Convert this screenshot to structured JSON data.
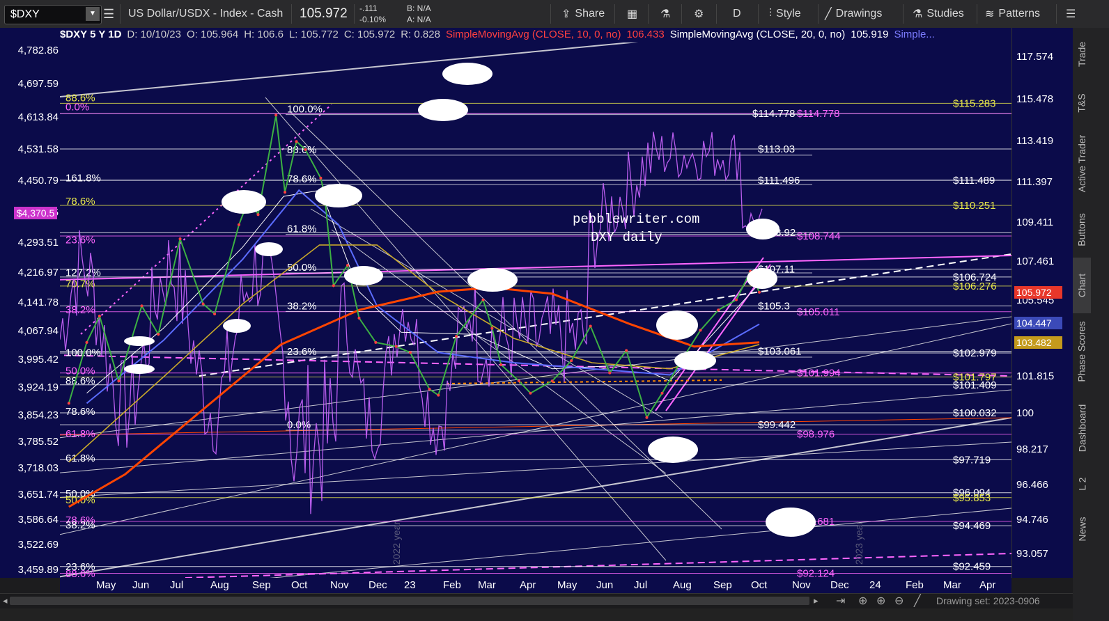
{
  "toolbar": {
    "symbol": "$DXY",
    "description": "US Dollar/USDX - Index - Cash",
    "price": "105.972",
    "change": "-.111",
    "change_pct": "-0.10%",
    "bid": "B: N/A",
    "ask": "A: N/A",
    "share": "Share",
    "period": "D",
    "style": "Style",
    "drawings": "Drawings",
    "studies": "Studies",
    "patterns": "Patterns"
  },
  "infobar": {
    "title": "$DXY 5 Y 1D",
    "date": "D: 10/10/23",
    "open": "O: 105.964",
    "high": "H: 106.6",
    "low": "L: 105.772",
    "close": "C: 105.972",
    "range": "R: 0.828",
    "sma10_label": "SimpleMovingAvg (CLOSE, 10, 0, no)",
    "sma10_value": "106.433",
    "sma20_label": "SimpleMovingAvg (CLOSE, 20, 0, no)",
    "sma20_value": "105.919",
    "more": "Simple..."
  },
  "sidebar": [
    "Trade",
    "T&S",
    "Active Trader",
    "Buttons",
    "Chart",
    "Phase Scores",
    "Dashboard",
    "L 2",
    "News"
  ],
  "bottom": {
    "drawing_set": "Drawing set: 2023-0906"
  },
  "colors": {
    "background": "#0b0b4a",
    "price": "#e0e0e0",
    "ma_red": "#ff4500",
    "ma_blue": "#5b6cff",
    "ma_gold": "#c8a82a",
    "oscillator": "#cc66ff",
    "fib_yellow": "#e8e84a",
    "fib_magenta": "#ff66ff"
  },
  "chart_data": {
    "type": "line",
    "title": "$DXY 5 Y 1D",
    "watermark": "pebblewriter.com\nDXY daily",
    "period_labels": [
      "2022 year",
      "2023 year"
    ],
    "left_axis_ticks": [
      "4,782.86",
      "4,697.59",
      "4,613.84",
      "4,531.58",
      "4,450.79",
      "4,370.5",
      "4,293.51",
      "4,216.97",
      "4,141.78",
      "4,067.94",
      "3,995.42",
      "3,924.19",
      "3,854.23",
      "3,785.52",
      "3,718.03",
      "3,651.74",
      "3,586.64",
      "3,522.69",
      "3,459.89"
    ],
    "right_axis_ticks": [
      "117.574",
      "115.478",
      "113.419",
      "111.397",
      "109.411",
      "107.461",
      "105.545",
      "101.815",
      "100",
      "98.217",
      "96.466",
      "94.746",
      "93.057"
    ],
    "x_ticks": [
      "May",
      "Jun",
      "Jul",
      "Aug",
      "Sep",
      "Oct",
      "Nov",
      "Dec",
      "23",
      "Feb",
      "Mar",
      "Apr",
      "May",
      "Jun",
      "Jul",
      "Aug",
      "Sep",
      "Oct",
      "Nov",
      "Dec",
      "24",
      "Feb",
      "Mar",
      "Apr"
    ],
    "ylim": [
      91.9,
      119.0
    ],
    "left_ylim": [
      3440,
      4842
    ],
    "current_price": 105.972,
    "price_badges": [
      {
        "label": "105.972",
        "color": "#e8372a",
        "value": 105.972
      },
      {
        "label": "104.447",
        "color": "#3b4ab8",
        "value": 104.447
      },
      {
        "label": "103.482",
        "color": "#c49a1c",
        "value": 103.482
      }
    ],
    "left_badge": {
      "label": "$4,370.5",
      "value": 4370.5
    },
    "levels": [
      {
        "label": "$115.283",
        "value": 115.283,
        "color": "#e8e84a"
      },
      {
        "label": "$114.778",
        "value": 114.778,
        "color": "#ffffff"
      },
      {
        "label": "$114.778",
        "value": 114.778,
        "color": "#ff66ff"
      },
      {
        "label": "$113.03",
        "value": 113.03,
        "color": "#ffffff"
      },
      {
        "label": "$111.496",
        "value": 111.496,
        "color": "#ffffff"
      },
      {
        "label": "$111.489",
        "value": 111.489,
        "color": "#ffffff"
      },
      {
        "label": "$110.251",
        "value": 110.251,
        "color": "#e8e84a"
      },
      {
        "label": "$108.92",
        "value": 108.92,
        "color": "#ffffff"
      },
      {
        "label": "$108.744",
        "value": 108.744,
        "color": "#ff66ff"
      },
      {
        "label": "$107.11",
        "value": 107.11,
        "color": "#ffffff"
      },
      {
        "label": "$106.724",
        "value": 106.724,
        "color": "#ffffff"
      },
      {
        "label": "$106.276",
        "value": 106.276,
        "color": "#e8e84a"
      },
      {
        "label": "$105.3",
        "value": 105.3,
        "color": "#ffffff"
      },
      {
        "label": "$105.011",
        "value": 105.011,
        "color": "#ff66ff"
      },
      {
        "label": "$103.061",
        "value": 103.061,
        "color": "#ffffff"
      },
      {
        "label": "$102.979",
        "value": 102.979,
        "color": "#ffffff"
      },
      {
        "label": "$101.994",
        "value": 101.994,
        "color": "#ff66ff"
      },
      {
        "label": "$101.797",
        "value": 101.797,
        "color": "#e8e84a"
      },
      {
        "label": "$101.409",
        "value": 101.409,
        "color": "#ffffff"
      },
      {
        "label": "$100.032",
        "value": 100.032,
        "color": "#ffffff"
      },
      {
        "label": "$99.442",
        "value": 99.442,
        "color": "#ffffff"
      },
      {
        "label": "$98.976",
        "value": 98.976,
        "color": "#ff66ff"
      },
      {
        "label": "$97.719",
        "value": 97.719,
        "color": "#ffffff"
      },
      {
        "label": "$96.094",
        "value": 96.094,
        "color": "#ffffff"
      },
      {
        "label": "$95.853",
        "value": 95.853,
        "color": "#e8e84a"
      },
      {
        "label": "$94.681",
        "value": 94.681,
        "color": "#ff66ff"
      },
      {
        "label": "$94.469",
        "value": 94.469,
        "color": "#ffffff"
      },
      {
        "label": "$92.459",
        "value": 92.459,
        "color": "#ffffff"
      },
      {
        "label": "$92.124",
        "value": 92.124,
        "color": "#ff66ff"
      }
    ],
    "fib_left": [
      {
        "label": "88.6%",
        "value": 115.55,
        "color": "#e8e84a"
      },
      {
        "label": "0.0%",
        "value": 115.1,
        "color": "#ff66ff"
      },
      {
        "label": "161.8%",
        "value": 111.6,
        "color": "#ffffff"
      },
      {
        "label": "78.6%",
        "value": 110.45,
        "color": "#e8e84a"
      },
      {
        "label": "23.6%",
        "value": 108.55,
        "color": "#ff66ff"
      },
      {
        "label": "127.2%",
        "value": 106.95,
        "color": "#ffffff"
      },
      {
        "label": "70.7%",
        "value": 106.4,
        "color": "#e8e84a"
      },
      {
        "label": "38.2%",
        "value": 105.1,
        "color": "#ff66ff"
      },
      {
        "label": "100.0%",
        "value": 103.0,
        "color": "#ffffff"
      },
      {
        "label": "50.0%",
        "value": 102.1,
        "color": "#ff66ff"
      },
      {
        "label": "88.6%",
        "value": 101.6,
        "color": "#ffffff"
      },
      {
        "label": "78.6%",
        "value": 100.1,
        "color": "#ffffff"
      },
      {
        "label": "61.8%",
        "value": 99.0,
        "color": "#ff66ff"
      },
      {
        "label": "61.8%",
        "value": 97.8,
        "color": "#ffffff"
      },
      {
        "label": "50.0%",
        "value": 96.05,
        "color": "#ffffff"
      },
      {
        "label": "50.0%",
        "value": 95.75,
        "color": "#e8e84a"
      },
      {
        "label": "78.6%",
        "value": 94.75,
        "color": "#ff66ff"
      },
      {
        "label": "38.2%",
        "value": 94.5,
        "color": "#ffffff"
      },
      {
        "label": "23.6%",
        "value": 92.45,
        "color": "#ffffff"
      },
      {
        "label": "88.6%",
        "value": 92.1,
        "color": "#ff66ff"
      }
    ],
    "fib_mid": [
      {
        "label": "100.0%",
        "value": 115.0
      },
      {
        "label": "88.6%",
        "value": 113.0
      },
      {
        "label": "78.6%",
        "value": 111.55
      },
      {
        "label": "61.8%",
        "value": 109.1
      },
      {
        "label": "50.0%",
        "value": 107.2
      },
      {
        "label": "38.2%",
        "value": 105.3
      },
      {
        "label": "23.6%",
        "value": 103.05
      },
      {
        "label": "0.0%",
        "value": 99.45
      }
    ],
    "series": [
      {
        "name": "$DXY",
        "values": [
          [
            "2022-04-18",
            100.5
          ],
          [
            "2022-05-02",
            103.5
          ],
          [
            "2022-05-12",
            104.8
          ],
          [
            "2022-05-27",
            101.6
          ],
          [
            "2022-06-14",
            105.3
          ],
          [
            "2022-06-27",
            103.9
          ],
          [
            "2022-07-14",
            108.6
          ],
          [
            "2022-08-01",
            105.4
          ],
          [
            "2022-08-10",
            104.9
          ],
          [
            "2022-08-29",
            109.3
          ],
          [
            "2022-09-06",
            110.6
          ],
          [
            "2022-09-13",
            109.8
          ],
          [
            "2022-09-27",
            114.7
          ],
          [
            "2022-10-04",
            110.9
          ],
          [
            "2022-10-13",
            113.4
          ],
          [
            "2022-10-20",
            113.0
          ],
          [
            "2022-11-01",
            111.6
          ],
          [
            "2022-11-04",
            110.8
          ],
          [
            "2022-11-11",
            106.3
          ],
          [
            "2022-11-22",
            107.3
          ],
          [
            "2022-12-01",
            104.7
          ],
          [
            "2022-12-14",
            103.5
          ],
          [
            "2022-12-30",
            103.3
          ],
          [
            "2023-01-10",
            103.0
          ],
          [
            "2023-01-25",
            101.2
          ],
          [
            "2023-02-01",
            100.9
          ],
          [
            "2023-02-15",
            103.8
          ],
          [
            "2023-03-08",
            105.6
          ],
          [
            "2023-03-15",
            104.2
          ],
          [
            "2023-03-22",
            102.4
          ],
          [
            "2023-04-05",
            101.6
          ],
          [
            "2023-04-14",
            101.0
          ],
          [
            "2023-05-01",
            101.6
          ],
          [
            "2023-05-16",
            102.6
          ],
          [
            "2023-05-31",
            104.3
          ],
          [
            "2023-06-15",
            102.0
          ],
          [
            "2023-06-28",
            103.1
          ],
          [
            "2023-07-14",
            99.8
          ],
          [
            "2023-07-26",
            101.0
          ],
          [
            "2023-08-10",
            102.6
          ],
          [
            "2023-08-25",
            104.1
          ],
          [
            "2023-09-08",
            105.1
          ],
          [
            "2023-09-22",
            105.6
          ],
          [
            "2023-10-03",
            107.0
          ],
          [
            "2023-10-10",
            105.972
          ]
        ]
      },
      {
        "name": "SMA 10",
        "values": [
          [
            "2022-05-02",
            101.0
          ],
          [
            "2022-07-01",
            104.2
          ],
          [
            "2022-09-01",
            108.2
          ],
          [
            "2022-10-03",
            110.7
          ],
          [
            "2022-11-01",
            111.0
          ],
          [
            "2022-12-01",
            106.0
          ],
          [
            "2023-01-03",
            104.0
          ],
          [
            "2023-03-01",
            103.9
          ],
          [
            "2023-05-01",
            102.2
          ],
          [
            "2023-07-03",
            102.4
          ],
          [
            "2023-08-01",
            101.6
          ],
          [
            "2023-10-10",
            106.4
          ]
        ]
      },
      {
        "name": "SMA 20",
        "values": [
          [
            "2022-05-02",
            100.5
          ],
          [
            "2022-07-01",
            103.6
          ],
          [
            "2022-09-01",
            107.6
          ],
          [
            "2022-10-15",
            111.0
          ],
          [
            "2022-11-15",
            109.3
          ],
          [
            "2022-12-15",
            105.3
          ],
          [
            "2023-02-01",
            103.0
          ],
          [
            "2023-04-01",
            102.5
          ],
          [
            "2023-06-01",
            102.2
          ],
          [
            "2023-08-01",
            101.9
          ],
          [
            "2023-10-10",
            104.4
          ]
        ]
      },
      {
        "name": "SMA 50",
        "values": [
          [
            "2022-04-18",
            97.6
          ],
          [
            "2022-07-01",
            101.8
          ],
          [
            "2022-09-01",
            105.4
          ],
          [
            "2022-10-31",
            108.3
          ],
          [
            "2022-12-15",
            108.3
          ],
          [
            "2023-02-01",
            105.9
          ],
          [
            "2023-04-01",
            103.7
          ],
          [
            "2023-06-01",
            102.5
          ],
          [
            "2023-08-01",
            102.2
          ],
          [
            "2023-10-10",
            103.4
          ]
        ]
      },
      {
        "name": "SMA 200",
        "values": [
          [
            "2022-04-18",
            95.4
          ],
          [
            "2022-06-01",
            97.0
          ],
          [
            "2022-08-01",
            100.2
          ],
          [
            "2022-10-01",
            103.4
          ],
          [
            "2022-12-01",
            105.1
          ],
          [
            "2023-02-01",
            106.0
          ],
          [
            "2023-03-15",
            106.2
          ],
          [
            "2023-05-01",
            105.9
          ],
          [
            "2023-07-01",
            104.4
          ],
          [
            "2023-08-20",
            103.3
          ],
          [
            "2023-10-10",
            103.5
          ]
        ]
      }
    ]
  }
}
